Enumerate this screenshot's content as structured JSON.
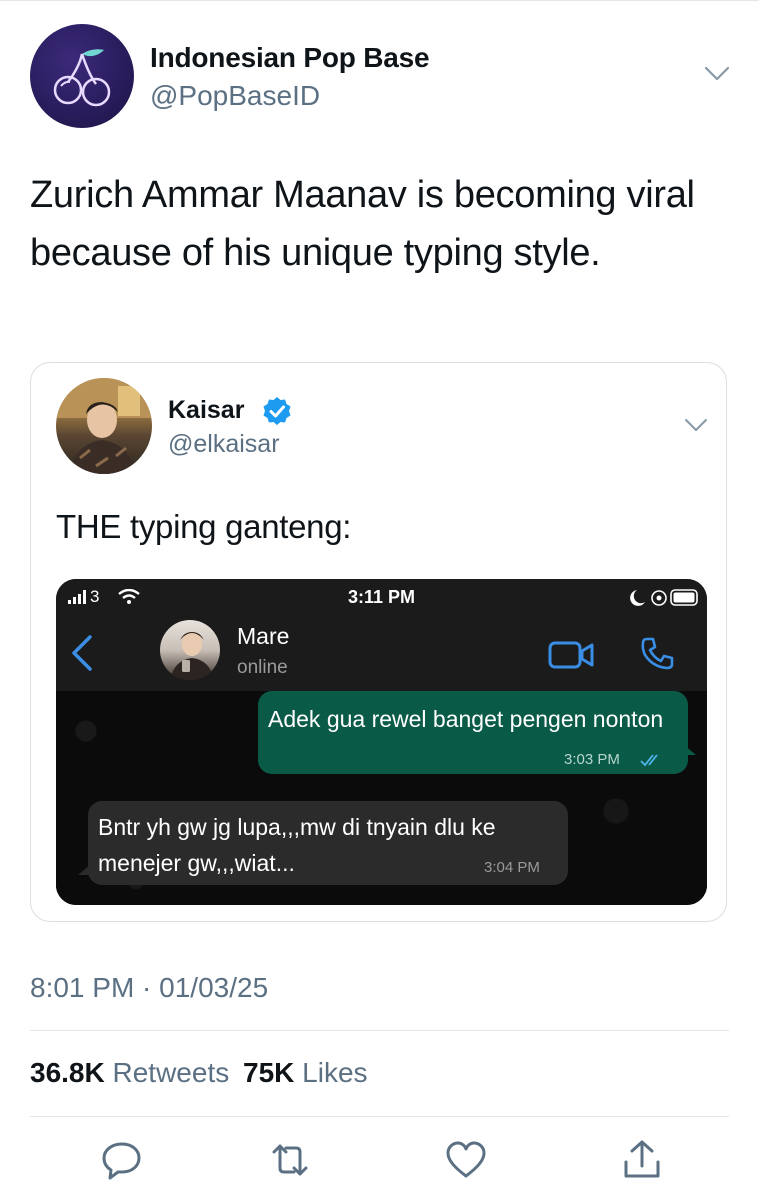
{
  "tweet": {
    "author_name": "Indonesian Pop Base",
    "author_handle": "@PopBaseID",
    "text": "Zurich Ammar Maanav is becoming viral because of his unique typing style.",
    "timestamp": "8:01 PM · 01/03/25",
    "retweet_count": "36.8K",
    "retweet_label": "Retweets",
    "like_count": "75K",
    "like_label": "Likes"
  },
  "quoted_tweet": {
    "author_name": "Kaisar",
    "author_handle": "@elkaisar",
    "verified": true,
    "text": "THE typing ganteng:"
  },
  "embedded_chat": {
    "status_bar": {
      "carrier": "3",
      "time": "3:11 PM"
    },
    "contact": {
      "name": "Mare",
      "status": "online"
    },
    "messages": [
      {
        "direction": "outgoing",
        "text": "Adek gua rewel banget pengen nonton",
        "time": "3:03 PM",
        "read": true
      },
      {
        "direction": "incoming",
        "text": "Bntr yh gw jg lupa,,,mw di tnyain dlu ke menejer gw,,,wiat...",
        "time": "3:04 PM"
      }
    ],
    "bubble_out_color": "#0a5a48",
    "bubble_in_color": "#2b2b2b"
  },
  "actions": [
    "reply-icon",
    "retweet-icon",
    "like-icon",
    "share-icon"
  ],
  "colors": {
    "accent": "#1d9bf0",
    "muted": "#5b7083",
    "text": "#0f1419"
  }
}
